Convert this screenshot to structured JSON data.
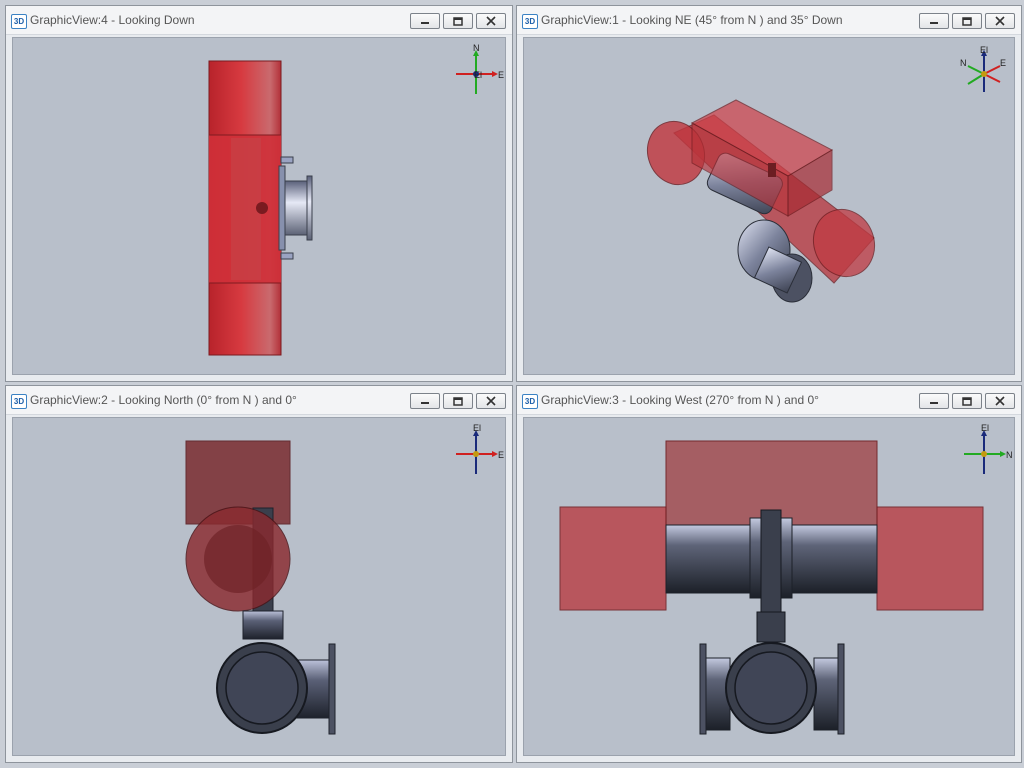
{
  "panes": [
    {
      "badge": "3D",
      "title": "GraphicView:4 - Looking Down"
    },
    {
      "badge": "3D",
      "title": "GraphicView:1 - Looking NE (45° from N ) and 35° Down"
    },
    {
      "badge": "3D",
      "title": "GraphicView:2 - Looking North (0° from N ) and 0°"
    },
    {
      "badge": "3D",
      "title": "GraphicView:3 - Looking West (270° from N ) and 0°"
    }
  ],
  "axes": {
    "north": "N",
    "east": "E",
    "elevation": "El"
  },
  "colors": {
    "viewport_bg": "#b8bfca",
    "pipe_red": "#cc2f35",
    "valve_steel": "#3a3f4c"
  }
}
